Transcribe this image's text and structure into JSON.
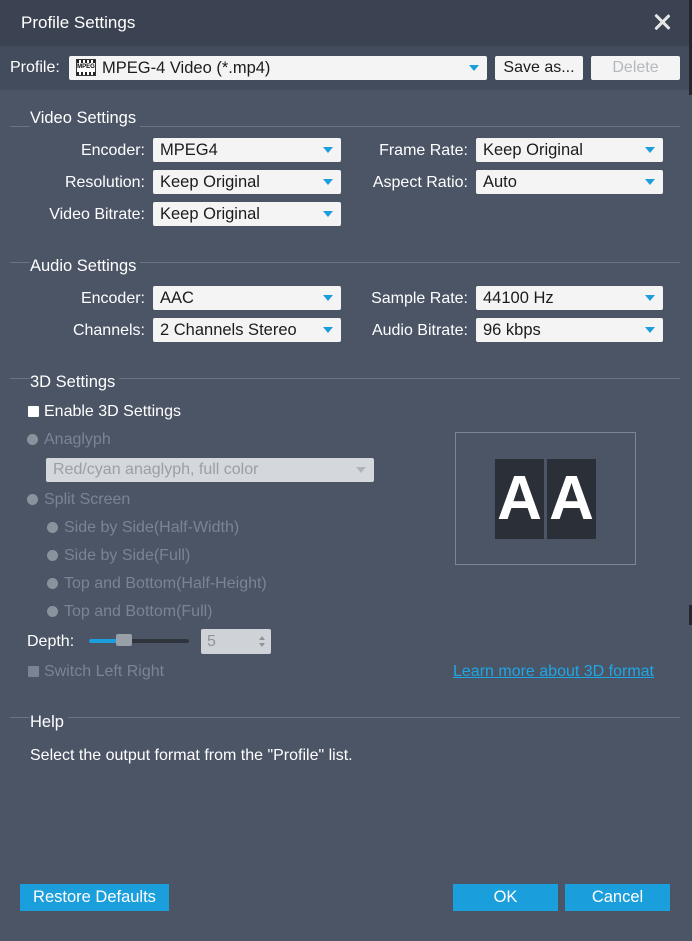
{
  "window": {
    "title": "Profile Settings"
  },
  "profile": {
    "label": "Profile:",
    "value": "MPEG-4 Video (*.mp4)",
    "icon_text": "MPEG",
    "save_as": "Save as...",
    "delete": "Delete"
  },
  "video": {
    "title": "Video Settings",
    "encoder_label": "Encoder:",
    "encoder": "MPEG4",
    "resolution_label": "Resolution:",
    "resolution": "Keep Original",
    "bitrate_label": "Video Bitrate:",
    "bitrate": "Keep Original",
    "framerate_label": "Frame Rate:",
    "framerate": "Keep Original",
    "aspect_label": "Aspect Ratio:",
    "aspect": "Auto"
  },
  "audio": {
    "title": "Audio Settings",
    "encoder_label": "Encoder:",
    "encoder": "AAC",
    "channels_label": "Channels:",
    "channels": "2 Channels Stereo",
    "samplerate_label": "Sample Rate:",
    "samplerate": "44100 Hz",
    "bitrate_label": "Audio Bitrate:",
    "bitrate": "96 kbps"
  },
  "three_d": {
    "title": "3D Settings",
    "enable": "Enable 3D Settings",
    "enabled": false,
    "anaglyph": "Anaglyph",
    "anaglyph_mode": "Red/cyan anaglyph, full color",
    "split_screen": "Split Screen",
    "sbs_half": "Side by Side(Half-Width)",
    "sbs_full": "Side by Side(Full)",
    "tb_half": "Top and Bottom(Half-Height)",
    "tb_full": "Top and Bottom(Full)",
    "depth_label": "Depth:",
    "depth_value": "5",
    "depth_level": 0.35,
    "switch_lr": "Switch Left Right",
    "learn_more": "Learn more about 3D format",
    "preview_left": "A",
    "preview_right": "A"
  },
  "help": {
    "title": "Help",
    "text": "Select the output format from the \"Profile\" list."
  },
  "buttons": {
    "restore": "Restore Defaults",
    "ok": "OK",
    "cancel": "Cancel"
  },
  "colors": {
    "background": "#4b5566",
    "titlebar": "#3b4353",
    "accent": "#1a9fdc",
    "link": "#1ea7e6"
  }
}
